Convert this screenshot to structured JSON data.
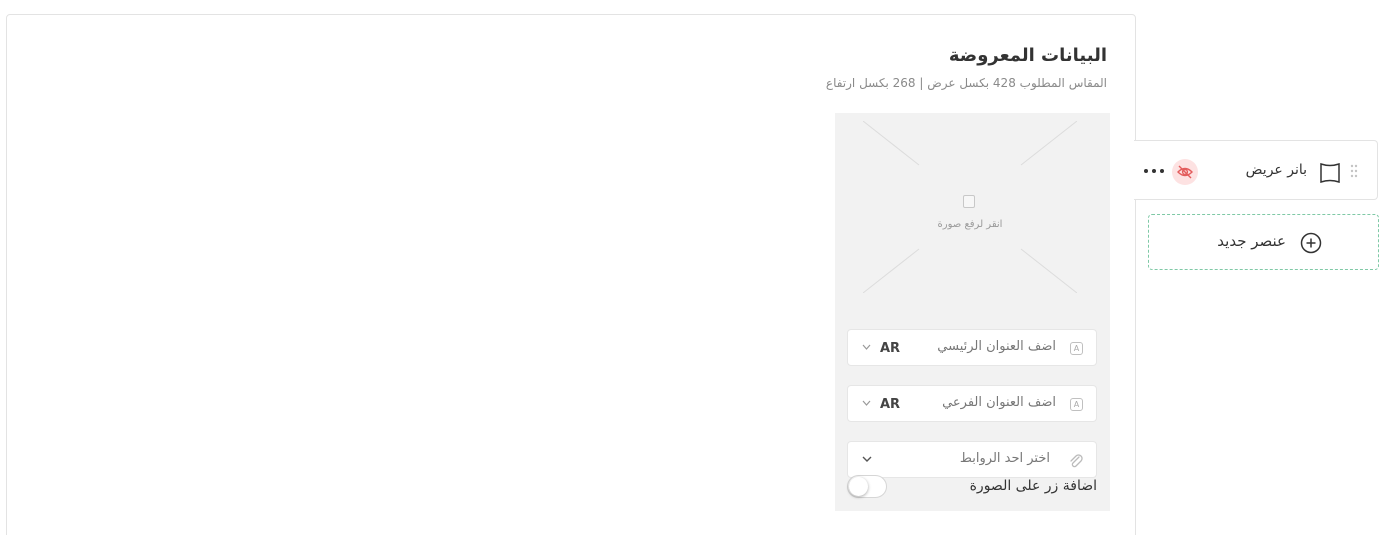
{
  "panel": {
    "title": "البيانات المعروضة",
    "subtitle": "المقاس المطلوب 428 بكسل عرض | 268 بكسل ارتفاع"
  },
  "upload": {
    "label": "انقر لرفع صورة",
    "icon": "image-placeholder-icon"
  },
  "fields": {
    "main_title": {
      "placeholder": "اضف العنوان الرئيسي",
      "lang": "AR",
      "icon": "text-field-icon"
    },
    "sub_title": {
      "placeholder": "اضف العنوان الفرعي",
      "lang": "AR",
      "icon": "text-field-icon"
    },
    "link": {
      "placeholder": "اختر احد الروابط",
      "icon": "paperclip-icon"
    }
  },
  "toggle": {
    "label": "اضافة زر على الصورة",
    "on": false
  },
  "sidebar": {
    "item": {
      "label": "بانر عريض",
      "icons": [
        "drag-handle-icon",
        "wide-banner-icon",
        "eye-off-icon",
        "more-dots-icon"
      ],
      "hide_bg_color": "#fde2e2",
      "hide_icon_color": "#e35d5d"
    },
    "new_item": {
      "label": "عنصر جديد",
      "icon": "plus-circle-icon",
      "border_color": "#7fc9a6"
    }
  }
}
